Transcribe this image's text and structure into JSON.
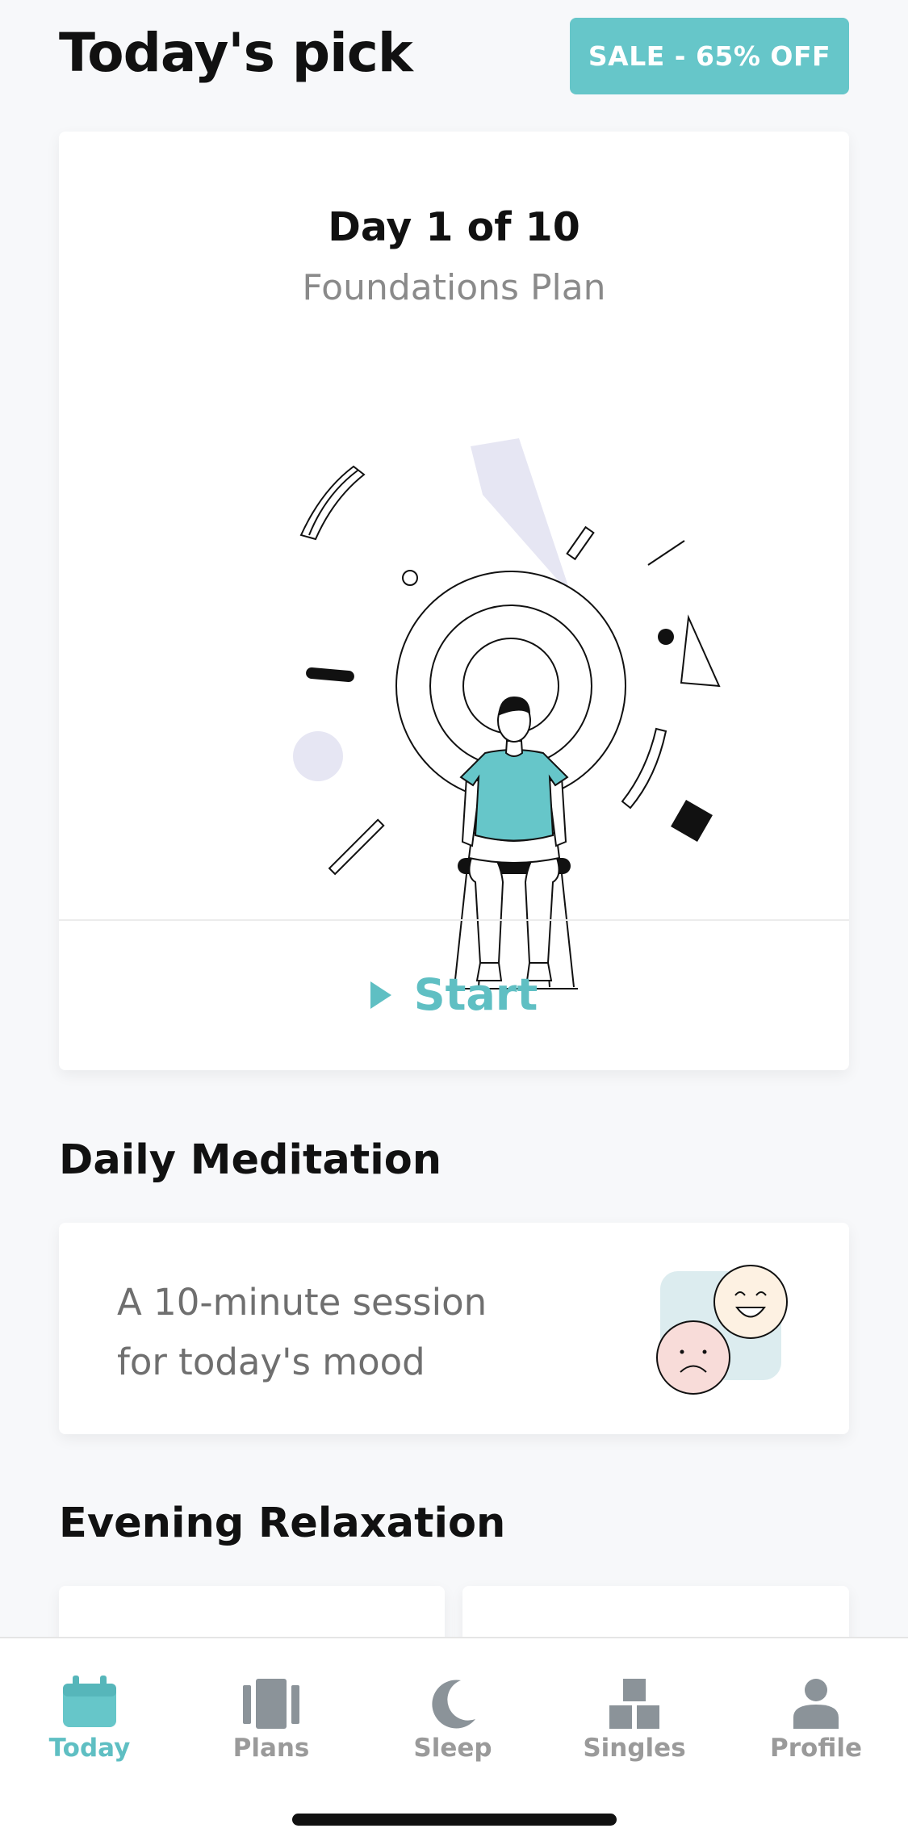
{
  "header": {
    "title": "Today's pick",
    "sale_badge": "SALE - 65% OFF"
  },
  "pick_card": {
    "day": "Day 1 of 10",
    "plan": "Foundations Plan",
    "illustration": "meditating-person-illustration",
    "start_label": "Start"
  },
  "daily_meditation": {
    "section_title": "Daily Meditation",
    "line1": "A 10-minute session",
    "line2": "for today's mood",
    "icon": "mood-faces-icon"
  },
  "evening": {
    "section_title": "Evening Relaxation"
  },
  "tabbar": {
    "items": [
      {
        "label": "Today",
        "icon": "calendar-icon",
        "active": true
      },
      {
        "label": "Plans",
        "icon": "plans-icon",
        "active": false
      },
      {
        "label": "Sleep",
        "icon": "moon-icon",
        "active": false
      },
      {
        "label": "Singles",
        "icon": "blocks-icon",
        "active": false
      },
      {
        "label": "Profile",
        "icon": "person-icon",
        "active": false
      }
    ]
  },
  "colors": {
    "accent": "#5fbfc3",
    "sale_bg": "#66c6c9",
    "tab_inactive": "#8b9399"
  }
}
